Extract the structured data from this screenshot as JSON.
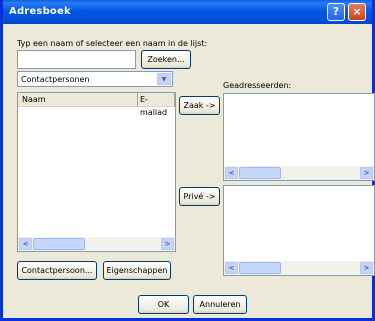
{
  "window": {
    "title": "Adresboek"
  },
  "titlebar_buttons": {
    "help": "?",
    "close": "×"
  },
  "search": {
    "prompt": "Typ een naam of selecteer een naam in de lijst:",
    "value": "",
    "button": "Zoeken..."
  },
  "source_combo": {
    "value": "Contactpersonen"
  },
  "contacts_list": {
    "columns": [
      "Naam",
      "E-mailad"
    ],
    "rows": []
  },
  "recipients": {
    "label": "Geadresseerden:"
  },
  "buttons": {
    "zaak": "Zaak ->",
    "prive": "Privé ->",
    "contactpersoon": "Contactpersoon...",
    "eigenschappen": "Eigenschappen",
    "ok": "OK",
    "annuleren": "Annuleren"
  },
  "icons": {
    "left": "left-arrow-icon",
    "right": "right-arrow-icon",
    "dropdown": "chevron-down-icon"
  }
}
